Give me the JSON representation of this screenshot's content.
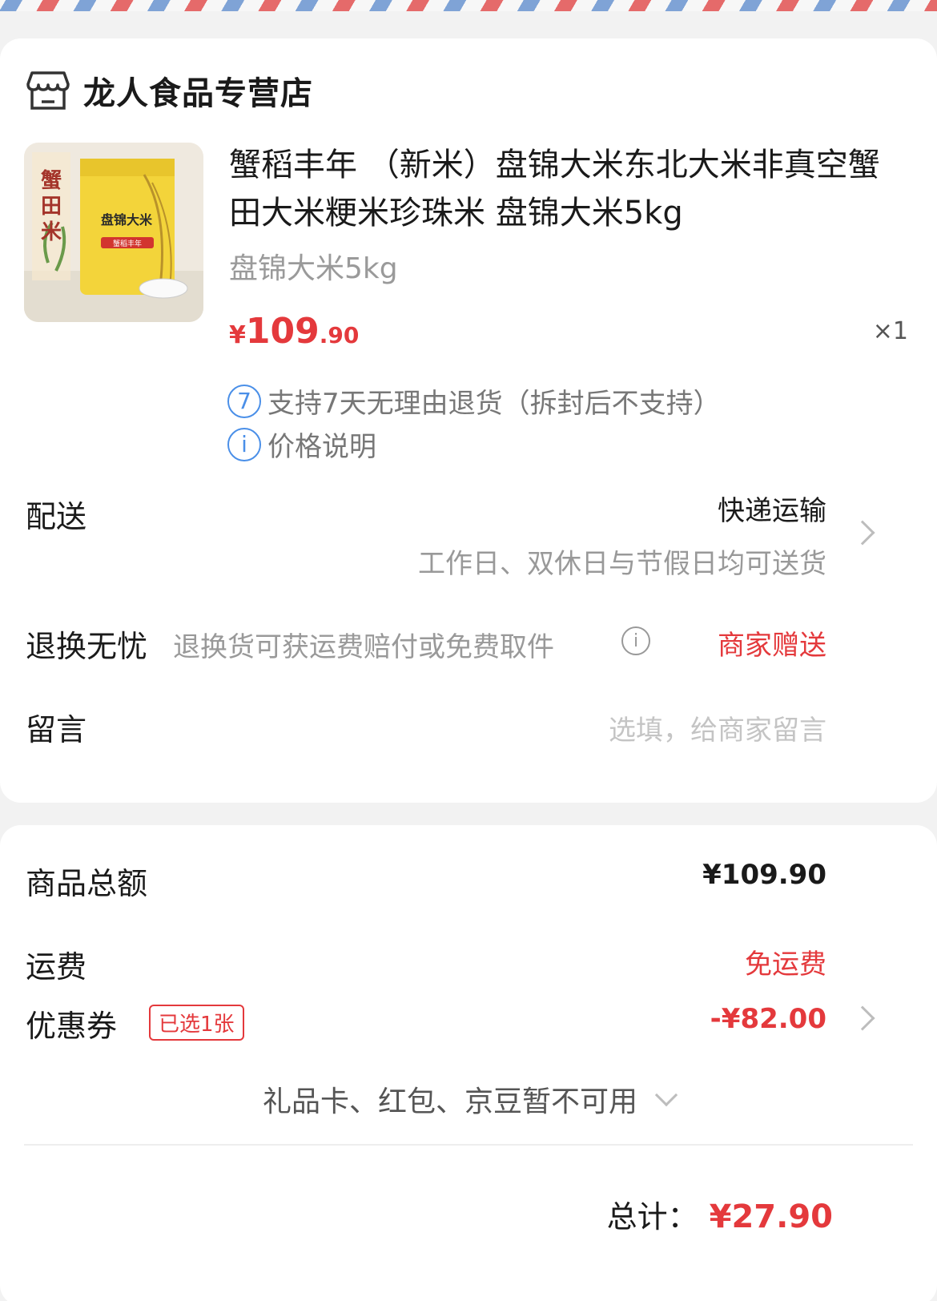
{
  "shop": {
    "name": "龙人食品专营店",
    "icon": "store-icon"
  },
  "product": {
    "title": "蟹稻丰年 （新米）盘锦大米东北大米非真空蟹田大米粳米珍珠米 盘锦大米5kg",
    "spec": "盘锦大米5kg",
    "price_symbol": "¥",
    "price_int": "109",
    "price_dec": ".90",
    "quantity": "×1",
    "image_texts": {
      "brand": "蟹田米",
      "bag_label": "盘锦大米",
      "bag_sub": "蟹稻丰年"
    },
    "policies": [
      {
        "icon": "7",
        "text": "支持7天无理由退货（拆封后不支持）"
      },
      {
        "icon": "i",
        "text": "价格说明"
      }
    ]
  },
  "delivery": {
    "label": "配送",
    "method": "快递运输",
    "note": "工作日、双休日与节假日均可送货"
  },
  "return": {
    "label": "退换无忧",
    "desc": "退换货可获运费赔付或免费取件",
    "value": "商家赠送"
  },
  "message": {
    "label": "留言",
    "placeholder": "选填，给商家留言"
  },
  "summary": {
    "goods_total_label": "商品总额",
    "goods_total_value": "¥109.90",
    "shipping_label": "运费",
    "shipping_value": "免运费",
    "coupon_label": "优惠券",
    "coupon_badge": "已选1张",
    "coupon_value": "-¥82.00",
    "unavailable": "礼品卡、红包、京豆暂不可用",
    "total_label": "总计：",
    "total_value": "¥27.90"
  },
  "colors": {
    "accent": "#e4393c",
    "info_blue": "#4a8fe8"
  }
}
